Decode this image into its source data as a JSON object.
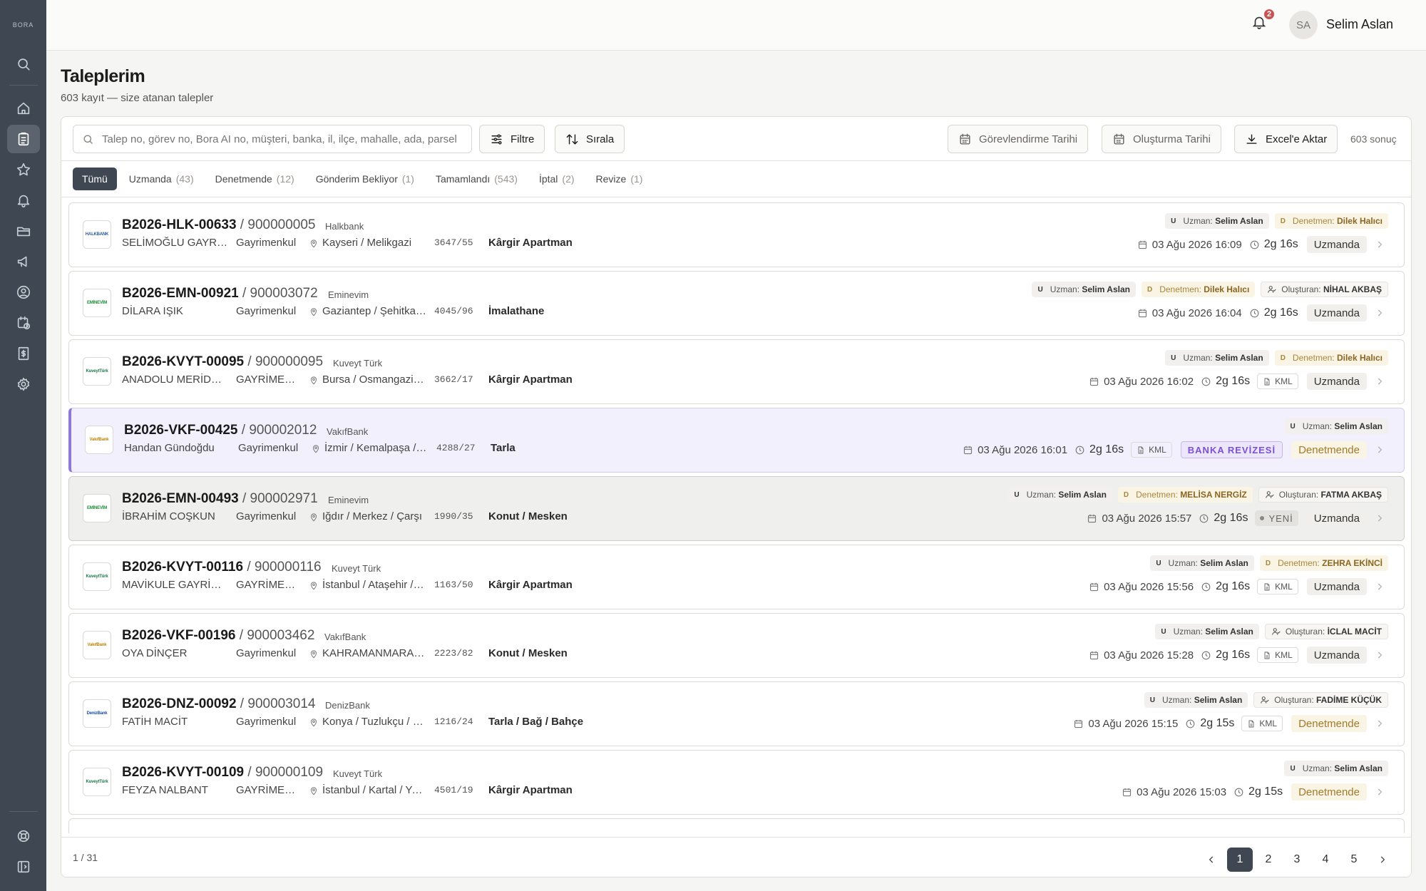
{
  "app": {
    "logo": "BORA",
    "user": {
      "initials": "SA",
      "name": "Selim Aslan"
    },
    "notification_count": "2"
  },
  "sidebar": {
    "top": [
      "search-icon"
    ],
    "items": [
      "home-icon",
      "clipboard-icon",
      "star-icon",
      "bell-icon",
      "folder-icon",
      "megaphone-icon",
      "user-circle-icon",
      "calendar-clock-icon",
      "invoice-icon",
      "gear-icon"
    ],
    "bottom": [
      "help-icon",
      "sidebar-collapse-icon"
    ]
  },
  "page": {
    "title": "Taleplerim",
    "subtitle": "603 kayıt — size atanan talepler"
  },
  "toolbar": {
    "search_placeholder": "Talep no, görev no, Bora AI no, müşteri, banka, il, ilçe, mahalle, ada, parsel",
    "filter_label": "Filtre",
    "sort_label": "Sırala",
    "assign_date_label": "Görevlendirme Tarihi",
    "create_date_label": "Oluşturma Tarihi",
    "excel_label": "Excel'e Aktar",
    "result_count": "603 sonuç"
  },
  "tabs": [
    {
      "label": "Tümü",
      "count": ""
    },
    {
      "label": "Uzmanda",
      "count": "(43)"
    },
    {
      "label": "Denetmende",
      "count": "(12)"
    },
    {
      "label": "Gönderim Bekliyor",
      "count": "(1)"
    },
    {
      "label": "Tamamlandı",
      "count": "(543)"
    },
    {
      "label": "İptal",
      "count": "(2)"
    },
    {
      "label": "Revize",
      "count": "(1)"
    }
  ],
  "labels": {
    "uzman": "Uzman:",
    "denetmen": "Denetmen:",
    "olusturan": "Oluşturan:",
    "kml": "KML",
    "u": "U",
    "d": "D"
  },
  "rows": [
    {
      "code": "B2026-HLK-00633",
      "no": "900000005",
      "bank": "Halkbank",
      "bank_logo": "HALKBANK",
      "logo_color": "#2a5c9a",
      "customer": "SELİMOĞLU GAYRİMENKUL",
      "type": "Gayrimenkul",
      "location": "Kayseri / Melikgazi",
      "parcel": "3647/55",
      "property": "Kârgir Apartman",
      "uzman": "Selim Aslan",
      "denetmen": "Dilek Halıcı",
      "olusturan": "",
      "date": "03 Ağu 2026 16:09",
      "duration": "2g 16s",
      "kml": false,
      "revize": "",
      "yeni": "",
      "status": "Uzmanda",
      "style": ""
    },
    {
      "code": "B2026-EMN-00921",
      "no": "900003072",
      "bank": "Eminevim",
      "bank_logo": "EMİNEVİM",
      "logo_color": "#1f8a3b",
      "customer": "DİLARA IŞIK",
      "type": "Gayrimenkul",
      "location": "Gaziantep / Şehitkamil",
      "parcel": "4045/96",
      "property": "İmalathane",
      "uzman": "Selim Aslan",
      "denetmen": "Dilek Halıcı",
      "olusturan": "NİHAL AKBAŞ",
      "date": "03 Ağu 2026 16:04",
      "duration": "2g 16s",
      "kml": false,
      "revize": "",
      "yeni": "",
      "status": "Uzmanda",
      "style": ""
    },
    {
      "code": "B2026-KVYT-00095",
      "no": "900000095",
      "bank": "Kuveyt Türk",
      "bank_logo": "KuveytTürk",
      "logo_color": "#1d7a4a",
      "customer": "ANADOLU MERİDYEN",
      "type": "GAYRİMENKUL",
      "location": "Bursa / Osmangazi / Alaşar",
      "parcel": "3662/17",
      "property": "Kârgir Apartman",
      "uzman": "Selim Aslan",
      "denetmen": "Dilek Halıcı",
      "olusturan": "",
      "date": "03 Ağu 2026 16:02",
      "duration": "2g 16s",
      "kml": true,
      "revize": "",
      "yeni": "",
      "status": "Uzmanda",
      "style": ""
    },
    {
      "code": "B2026-VKF-00425",
      "no": "900002012",
      "bank": "VakıfBank",
      "bank_logo": "VakıfBank",
      "logo_color": "#b8860b",
      "customer": "Handan Gündoğdu",
      "type": "Gayrimenkul",
      "location": "İzmir / Kemalpaşa / Ansızca",
      "parcel": "4288/27",
      "property": "Tarla",
      "uzman": "Selim Aslan",
      "denetmen": "",
      "olusturan": "",
      "date": "03 Ağu 2026 16:01",
      "duration": "2g 16s",
      "kml": true,
      "revize": "BANKA REVİZESİ",
      "yeni": "",
      "status": "Denetmende",
      "style": "hl"
    },
    {
      "code": "B2026-EMN-00493",
      "no": "900002971",
      "bank": "Eminevim",
      "bank_logo": "EMİNEVİM",
      "logo_color": "#1f8a3b",
      "customer": "İBRAHİM COŞKUN",
      "type": "Gayrimenkul",
      "location": "Iğdır / Merkez / Çarşı",
      "parcel": "1990/35",
      "property": "Konut / Mesken",
      "uzman": "Selim Aslan",
      "denetmen": "MELİSA NERGİZ",
      "olusturan": "FATMA AKBAŞ",
      "date": "03 Ağu 2026 15:57",
      "duration": "2g 16s",
      "kml": false,
      "revize": "",
      "yeni": "YENİ",
      "status": "Uzmanda",
      "style": "gray"
    },
    {
      "code": "B2026-KVYT-00116",
      "no": "900000116",
      "bank": "Kuveyt Türk",
      "bank_logo": "KuveytTürk",
      "logo_color": "#1d7a4a",
      "customer": "MAVİKULE GAYRİMENKUL",
      "type": "GAYRİMENKUL",
      "location": "İstanbul / Ataşehir / Barbaros",
      "parcel": "1163/50",
      "property": "Kârgir Apartman",
      "uzman": "Selim Aslan",
      "denetmen": "ZEHRA EKİNCİ",
      "olusturan": "",
      "date": "03 Ağu 2026 15:56",
      "duration": "2g 16s",
      "kml": true,
      "revize": "",
      "yeni": "",
      "status": "Uzmanda",
      "style": ""
    },
    {
      "code": "B2026-VKF-00196",
      "no": "900003462",
      "bank": "VakıfBank",
      "bank_logo": "VakıfBank",
      "logo_color": "#b8860b",
      "customer": "OYA DİNÇER",
      "type": "Gayrimenkul",
      "location": "KAHRAMANMARAŞ / Onikişubat",
      "parcel": "2223/82",
      "property": "Konut / Mesken",
      "uzman": "Selim Aslan",
      "denetmen": "",
      "olusturan": "İCLAL MACİT",
      "date": "03 Ağu 2026 15:28",
      "duration": "2g 16s",
      "kml": true,
      "revize": "",
      "yeni": "",
      "status": "Uzmanda",
      "style": ""
    },
    {
      "code": "B2026-DNZ-00092",
      "no": "900003014",
      "bank": "DenizBank",
      "bank_logo": "DenizBank",
      "logo_color": "#1c4f9c",
      "customer": "FATİH MACİT",
      "type": "Gayrimenkul",
      "location": "Konya / Tuzlukçu / Merkez",
      "parcel": "1216/24",
      "property": "Tarla / Bağ / Bahçe",
      "uzman": "Selim Aslan",
      "denetmen": "",
      "olusturan": "FADİME KÜÇÜK",
      "date": "03 Ağu 2026 15:15",
      "duration": "2g 15s",
      "kml": true,
      "revize": "",
      "yeni": "",
      "status": "Denetmende",
      "style": ""
    },
    {
      "code": "B2026-KVYT-00109",
      "no": "900000109",
      "bank": "Kuveyt Türk",
      "bank_logo": "KuveytTürk",
      "logo_color": "#1d7a4a",
      "customer": "FEYZA NALBANT",
      "type": "GAYRİMENKUL",
      "location": "İstanbul / Kartal / Yakacık",
      "parcel": "4501/19",
      "property": "Kârgir Apartman",
      "uzman": "Selim Aslan",
      "denetmen": "",
      "olusturan": "",
      "date": "03 Ağu 2026 15:03",
      "duration": "2g 15s",
      "kml": false,
      "revize": "",
      "yeni": "",
      "status": "Denetmende",
      "style": ""
    }
  ],
  "pagination": {
    "info": "1 / 31",
    "pages": [
      "1",
      "2",
      "3",
      "4",
      "5"
    ],
    "current": "1"
  }
}
